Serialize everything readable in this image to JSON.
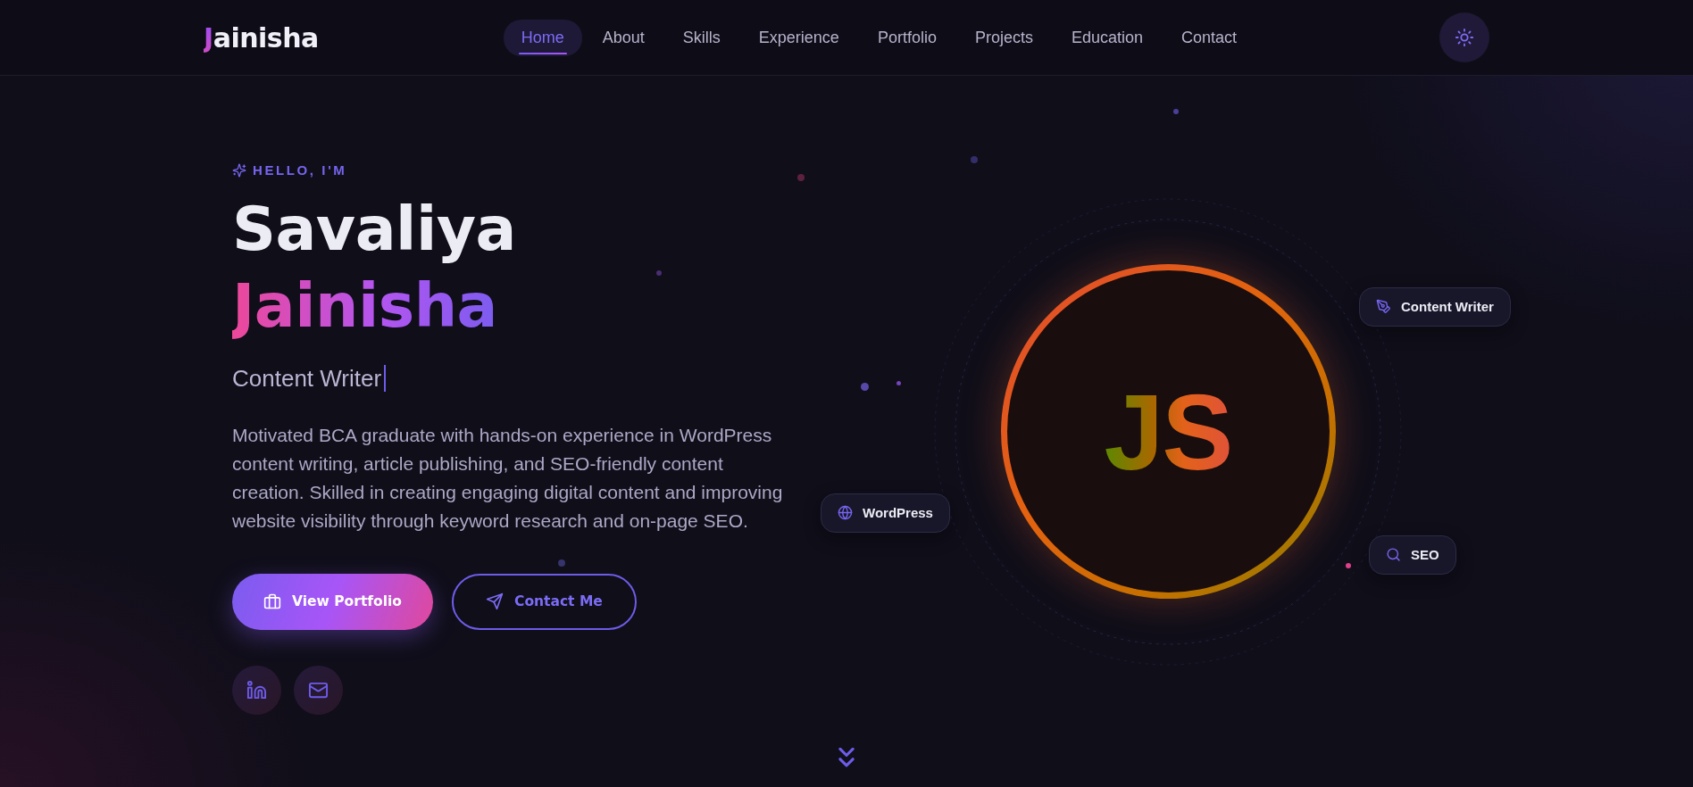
{
  "nav": {
    "logo": {
      "initial": "J",
      "rest": "ainisha"
    },
    "links": [
      {
        "label": "Home",
        "selected": true
      },
      {
        "label": "About",
        "selected": false
      },
      {
        "label": "Skills",
        "selected": false
      },
      {
        "label": "Experience",
        "selected": false
      },
      {
        "label": "Portfolio",
        "selected": false
      },
      {
        "label": "Projects",
        "selected": false
      },
      {
        "label": "Education",
        "selected": false
      },
      {
        "label": "Contact",
        "selected": false
      }
    ]
  },
  "hero": {
    "greeting": "HELLO, I'M",
    "name": {
      "first": "Savaliya",
      "last": "Jainisha"
    },
    "role": "Content Writer",
    "description": "Motivated BCA graduate with hands-on experience in WordPress content writing, article publishing, and SEO-friendly content creation. Skilled in creating engaging digital content and improving website visibility through keyword research and on-page SEO.",
    "buttons": [
      {
        "label": "View Portfolio",
        "kind": "primary"
      },
      {
        "label": "Contact Me",
        "kind": "outline"
      }
    ]
  },
  "profile": {
    "monogram": "JS",
    "badges": [
      {
        "label": "Content Writer"
      },
      {
        "label": "WordPress"
      },
      {
        "label": "SEO"
      }
    ]
  }
}
